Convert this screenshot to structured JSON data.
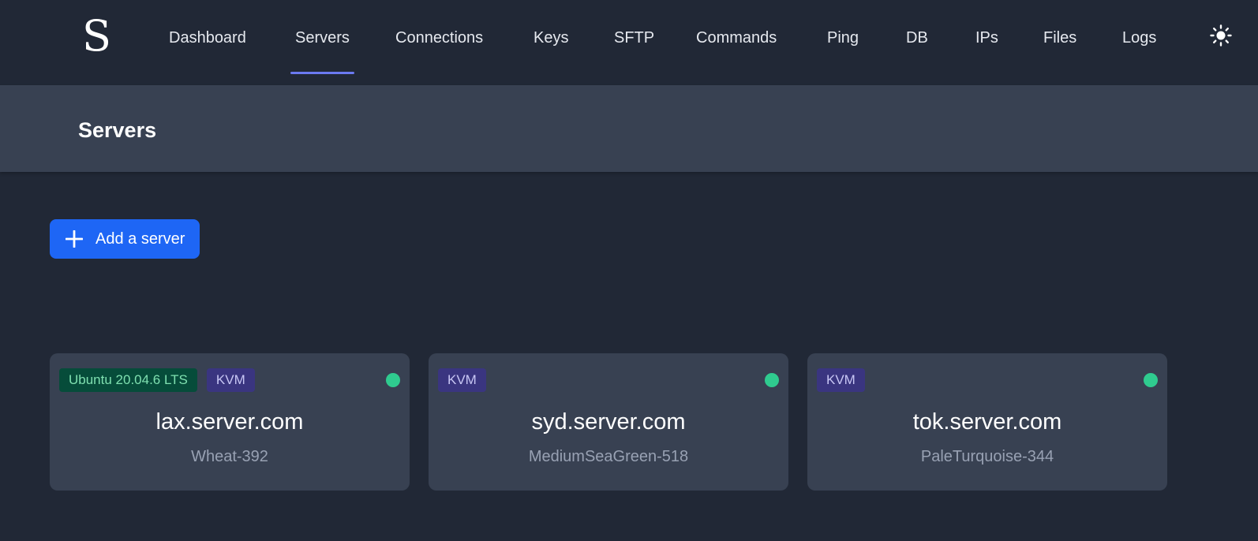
{
  "app": {
    "logo": "S"
  },
  "nav": {
    "items": [
      {
        "label": "Dashboard"
      },
      {
        "label": "Servers"
      },
      {
        "label": "Connections"
      },
      {
        "label": "Keys"
      },
      {
        "label": "SFTP"
      },
      {
        "label": "Commands"
      },
      {
        "label": "Ping"
      },
      {
        "label": "DB"
      },
      {
        "label": "IPs"
      },
      {
        "label": "Files"
      },
      {
        "label": "Logs"
      }
    ],
    "active": "Servers",
    "theme_icon": "sun-icon"
  },
  "header": {
    "title": "Servers"
  },
  "actions": {
    "add_server_label": "Add a server",
    "add_icon": "plus-icon"
  },
  "servers": [
    {
      "badges": [
        "Ubuntu 20.04.6 LTS",
        "KVM"
      ],
      "host": "lax.server.com",
      "alias": "Wheat-392",
      "status": "online"
    },
    {
      "badges": [
        "KVM"
      ],
      "host": "syd.server.com",
      "alias": "MediumSeaGreen-518",
      "status": "online"
    },
    {
      "badges": [
        "KVM"
      ],
      "host": "tok.server.com",
      "alias": "PaleTurquoise-344",
      "status": "online"
    }
  ],
  "colors": {
    "background": "#212836",
    "panel": "#384152",
    "accent": "#1e66f5",
    "active_underline": "#6b7af0",
    "status_online": "#2fcb8f",
    "os_badge_bg": "#064c3a",
    "virt_badge_bg": "#3a3580"
  }
}
